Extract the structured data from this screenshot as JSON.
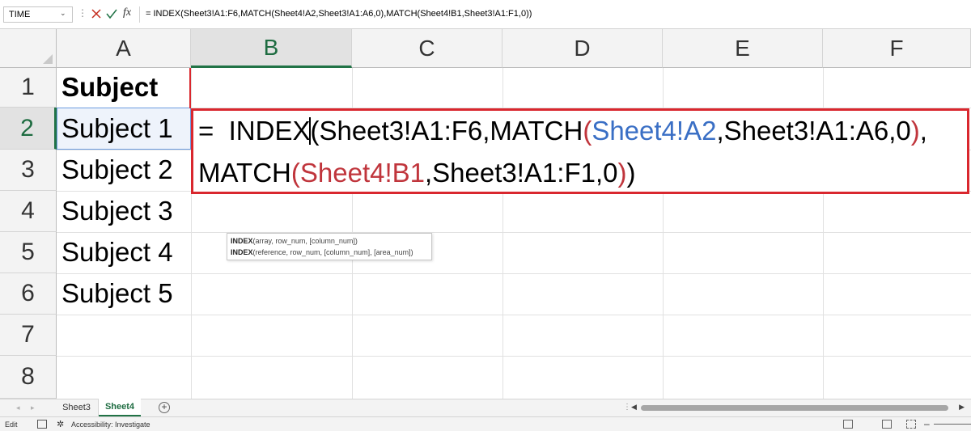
{
  "formula_bar": {
    "name_box": "TIME",
    "name_box_arrow": "⌄",
    "dots": "⋮",
    "fx": "fx",
    "formula": "= INDEX(Sheet3!A1:F6,MATCH(Sheet4!A2,Sheet3!A1:A6,0),MATCH(Sheet4!B1,Sheet3!A1:F1,0))"
  },
  "columns": [
    "A",
    "B",
    "C",
    "D",
    "E",
    "F"
  ],
  "rows": [
    "1",
    "2",
    "3",
    "4",
    "5",
    "6",
    "7",
    "8"
  ],
  "cells": {
    "A1": "Subject",
    "A2": "Subject 1",
    "A3": "Subject 2",
    "A4": "Subject 3",
    "A5": "Subject 4",
    "A6": "Subject 5"
  },
  "formula_overlay": {
    "line1": {
      "p1": "=  INDEX",
      "p2": "(Sheet3!A1:F6,MATCH",
      "p3": "(",
      "p4": "Sheet4!A2",
      "p5": ",Sheet3!A1:A6,0",
      "p6": ")",
      "p7": ","
    },
    "line2": {
      "p1": "MATCH",
      "p2": "(",
      "p3": "Sheet4!B1",
      "p4": ",Sheet3!A1:F1,0",
      "p5": ")",
      "p6": ")"
    }
  },
  "tooltip": {
    "line1_fn": "INDEX",
    "line1_args": "(array, row_num, [column_num])",
    "line2_fn": "INDEX",
    "line2_args": "(reference, row_num, [column_num], [area_num])"
  },
  "sheet_tabs": {
    "tabs": [
      "Sheet3",
      "Sheet4"
    ],
    "active": "Sheet4",
    "add": "+",
    "nav_left": "◂",
    "nav_right": "▸",
    "dots": "⋮"
  },
  "status_bar": {
    "mode": "Edit",
    "accessibility": "Accessibility: Investigate",
    "zoom_minus": "–"
  },
  "colors": {
    "accent_green": "#217346",
    "formula_box_red": "#d9272e",
    "ref_blue": "#3a6fc5",
    "ref_red": "#c0353c"
  }
}
